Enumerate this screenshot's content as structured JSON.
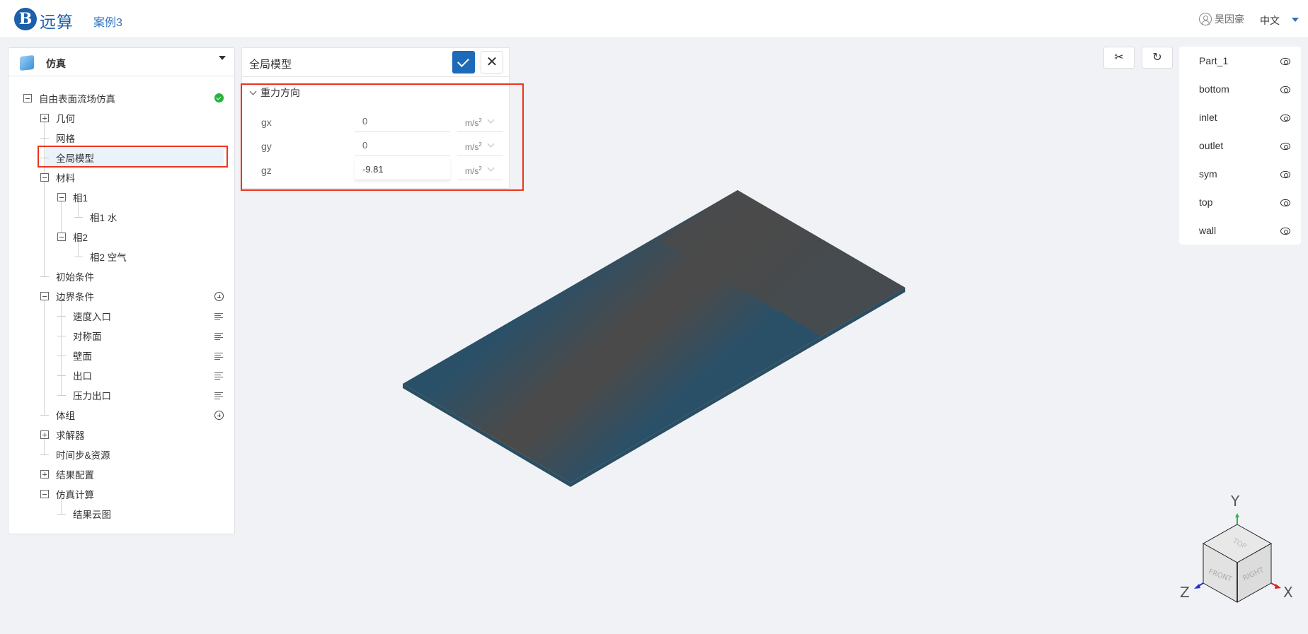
{
  "header": {
    "logo_glyph": "B",
    "brand": "远算",
    "case_name": "案例3",
    "user_name": "吴因豪",
    "language": "中文"
  },
  "sidebar": {
    "title": "仿真",
    "tree": [
      {
        "label": "自由表面流场仿真",
        "level": 0,
        "toggle": "minus",
        "status": "ok"
      },
      {
        "label": "几何",
        "level": 1,
        "toggle": "plus"
      },
      {
        "label": "网格",
        "level": 1,
        "toggle": "none"
      },
      {
        "label": "全局模型",
        "level": 1,
        "toggle": "none",
        "selected": true
      },
      {
        "label": "材料",
        "level": 1,
        "toggle": "minus"
      },
      {
        "label": "相1",
        "level": 2,
        "toggle": "minus"
      },
      {
        "label": "相1 水",
        "level": 3,
        "toggle": "none"
      },
      {
        "label": "相2",
        "level": 2,
        "toggle": "minus"
      },
      {
        "label": "相2 空气",
        "level": 3,
        "toggle": "none"
      },
      {
        "label": "初始条件",
        "level": 1,
        "toggle": "none"
      },
      {
        "label": "边界条件",
        "level": 1,
        "toggle": "minus",
        "action": "add"
      },
      {
        "label": "速度入口",
        "level": 2,
        "toggle": "none",
        "action": "menu"
      },
      {
        "label": "对称面",
        "level": 2,
        "toggle": "none",
        "action": "menu"
      },
      {
        "label": "壁面",
        "level": 2,
        "toggle": "none",
        "action": "menu"
      },
      {
        "label": "出口",
        "level": 2,
        "toggle": "none",
        "action": "menu"
      },
      {
        "label": "压力出口",
        "level": 2,
        "toggle": "none",
        "action": "menu"
      },
      {
        "label": "体组",
        "level": 1,
        "toggle": "none",
        "action": "add"
      },
      {
        "label": "求解器",
        "level": 1,
        "toggle": "plus"
      },
      {
        "label": "时间步&资源",
        "level": 1,
        "toggle": "none"
      },
      {
        "label": "结果配置",
        "level": 1,
        "toggle": "plus"
      },
      {
        "label": "仿真计算",
        "level": 1,
        "toggle": "minus"
      },
      {
        "label": "结果云图",
        "level": 2,
        "toggle": "none"
      }
    ]
  },
  "panel": {
    "title": "全局模型",
    "section": "重力方向",
    "fields": [
      {
        "label": "gx",
        "value": "0",
        "unit": "m/s",
        "unit_exp": "2"
      },
      {
        "label": "gy",
        "value": "0",
        "unit": "m/s",
        "unit_exp": "2"
      },
      {
        "label": "gz",
        "value": "-9.81",
        "unit": "m/s",
        "unit_exp": "2"
      }
    ]
  },
  "viewport": {
    "tools": {
      "cut": "✂",
      "reset": "↻"
    },
    "parts": [
      "Part_1",
      "bottom",
      "inlet",
      "outlet",
      "sym",
      "top",
      "wall"
    ],
    "axes": {
      "x": "X",
      "y": "Y",
      "z": "Z"
    },
    "cube_faces": {
      "top": "TOP",
      "front": "FRONT",
      "right": "RIGHT"
    },
    "colors": {
      "plate_edge": "#2a5068",
      "plate_center": "#4a4a4a",
      "highlight": "#f0331b",
      "accent": "#1d6ab8"
    }
  }
}
